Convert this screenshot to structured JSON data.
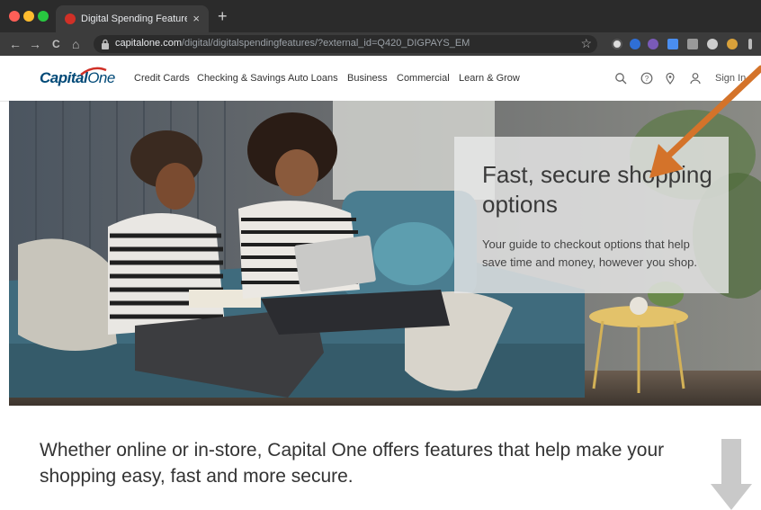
{
  "browser": {
    "tab_title": "Digital Spending Features | Ca",
    "tab_close": "×",
    "new_tab": "+",
    "url_host": "capitalone.com",
    "url_path": "/digital/digitalspendingfeatures/?external_id=Q420_DIGPAYS_EM",
    "back": "←",
    "forward": "→",
    "reload": "C",
    "home": "⌂",
    "star": "☆"
  },
  "site": {
    "logo_text": "Capital",
    "logo_text_2": "One",
    "nav": [
      "Credit Cards",
      "Checking & Savings",
      "Auto Loans",
      "Business",
      "Commercial",
      "Learn & Grow"
    ],
    "sign_in": "Sign In"
  },
  "hero": {
    "title": "Fast, secure shopping options",
    "subtitle": "Your guide to checkout options that help save time and money, however you shop."
  },
  "intro": "Whether online or in-store, Capital One offers features that help make your shopping easy, fast and more secure.",
  "colors": {
    "brand_blue": "#004977",
    "brand_red": "#d03027",
    "annotation_orange": "#d4732a"
  }
}
